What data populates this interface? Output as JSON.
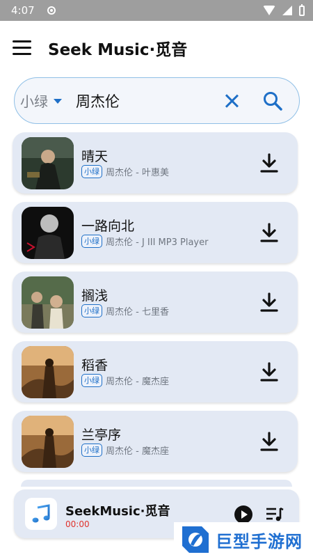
{
  "status_bar": {
    "time": "4:07"
  },
  "app_bar": {
    "title": "Seek Music·觅音"
  },
  "search": {
    "source": "小绿",
    "query": "周杰伦"
  },
  "songs": [
    {
      "title": "晴天",
      "badge": "小绿",
      "artist": "周杰伦 - 叶惠美"
    },
    {
      "title": "一路向北",
      "badge": "小绿",
      "artist": "周杰伦 - J III MP3 Player"
    },
    {
      "title": "搁浅",
      "badge": "小绿",
      "artist": "周杰伦 - 七里香"
    },
    {
      "title": "稻香",
      "badge": "小绿",
      "artist": "周杰伦 - 魔杰座"
    },
    {
      "title": "兰亭序",
      "badge": "小绿",
      "artist": "周杰伦 - 魔杰座"
    }
  ],
  "player": {
    "title": "SeekMusic·觅音",
    "time": "00:00"
  },
  "watermark": {
    "text": "巨型手游网"
  },
  "colors": {
    "accent": "#1e6fc7",
    "card": "#e3e9f4",
    "time_red": "#e0322c"
  },
  "icons": [
    "menu-icon",
    "chevron-down-icon",
    "close-icon",
    "search-icon",
    "download-icon",
    "music-note-icon",
    "play-icon",
    "queue-icon"
  ]
}
